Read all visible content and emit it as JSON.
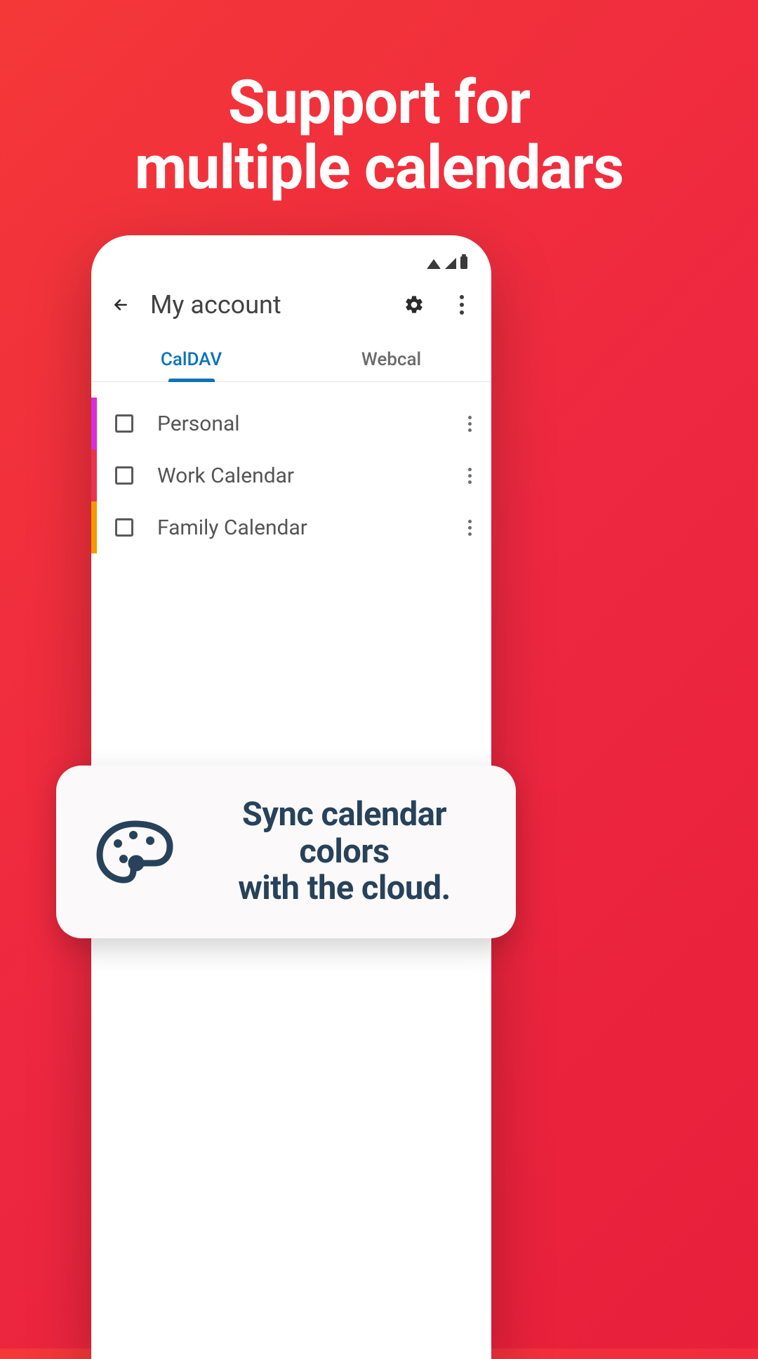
{
  "headline_l1": "Support for",
  "headline_l2": "multiple calendars",
  "app": {
    "title": "My account",
    "tabs": [
      {
        "label": "CalDAV",
        "active": true
      },
      {
        "label": "Webcal",
        "active": false
      }
    ],
    "calendars": [
      {
        "label": "Personal",
        "color": "#d82fd8"
      },
      {
        "label": "Work Calendar",
        "color": "#e8344d"
      },
      {
        "label": "Family Calendar",
        "color": "#f29a00"
      }
    ]
  },
  "callout": {
    "text_l1": "Sync calendar colors",
    "text_l2": "with the cloud."
  }
}
